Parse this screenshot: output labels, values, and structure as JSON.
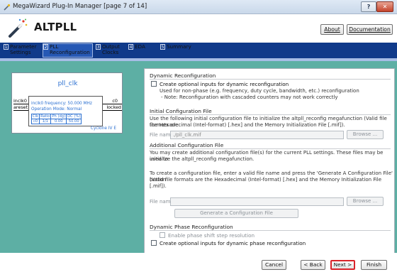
{
  "window": {
    "title": "MegaWizard Plug-In Manager [page 7 of 14]",
    "help_label": "?",
    "close_label": "✕"
  },
  "header": {
    "wizard_name": "ALTPLL",
    "about_label": "About",
    "documentation_label": "Documentation"
  },
  "tabs": [
    {
      "num": "1",
      "label": "Parameter Settings",
      "active": false
    },
    {
      "num": "2",
      "label": "PLL Reconfiguration",
      "active": true
    },
    {
      "num": "3",
      "label": "Output Clocks",
      "active": false
    },
    {
      "num": "4",
      "label": "EDA",
      "active": false
    },
    {
      "num": "5",
      "label": "Summary",
      "active": false
    }
  ],
  "block": {
    "name": "pll_clk",
    "info_line1": "inclk0 frequency: 50.000 MHz",
    "info_line2": "Operation Mode: Normal",
    "pin_inclk0": "inclk0",
    "pin_areset": "areset",
    "pin_c0": "c0",
    "pin_locked": "locked",
    "table_header": [
      "Clk",
      "Ratio",
      "Ph (dg)",
      "DC (%)"
    ],
    "table_row": [
      "c0",
      "1/1",
      "0.00",
      "50.00"
    ],
    "family": "Cyclone IV E"
  },
  "dynamic_reconfig": {
    "title": "Dynamic Reconfiguration",
    "checkbox_label": "Create optional inputs for dynamic reconfiguration",
    "note1": "Used for non-phase (e.g. frequency, duty cycle, bandwidth, etc.) reconfiguration",
    "note2": "- Note: Reconfiguration with cascaded counters may not work correctly"
  },
  "initial_config": {
    "title": "Initial Configuration File",
    "desc1": "Use the following initial configuration file to initialize the altpll_reconfig megafunction (Valid file formats are",
    "desc2": "the Hexadecimal (Intel-format) [.hex] and the Memory Initialization File [.mif]).",
    "file_label": "File name:",
    "file_value": "./pll_clk.mif",
    "browse_label": "Browse ..."
  },
  "additional_config": {
    "title": "Additional Configuration File",
    "desc1": "You may create additional configuration file(s) for the current PLL settings. These files may be used to",
    "desc2": "initialize the altpll_reconfig megafunction.",
    "desc3": "To create a configuration file, enter a valid file name and press the 'Generate A Configuration File' button",
    "desc4": "(Valid file formats are the Hexadecimal (Intel-format) [.hex] and the Memory Initialization File [.mif]).",
    "file_label": "File name:",
    "file_value": "",
    "browse_label": "Browse ...",
    "generate_label": "Generate a Configuration File"
  },
  "dynamic_phase": {
    "title": "Dynamic Phase Reconfiguration",
    "enable_label": "Enable phase shift step resolution",
    "create_label": "Create optional inputs for dynamic phase reconfiguration"
  },
  "footer": {
    "cancel_label": "Cancel",
    "back_label": "< Back",
    "next_label": "Next >",
    "finish_label": "Finish"
  }
}
